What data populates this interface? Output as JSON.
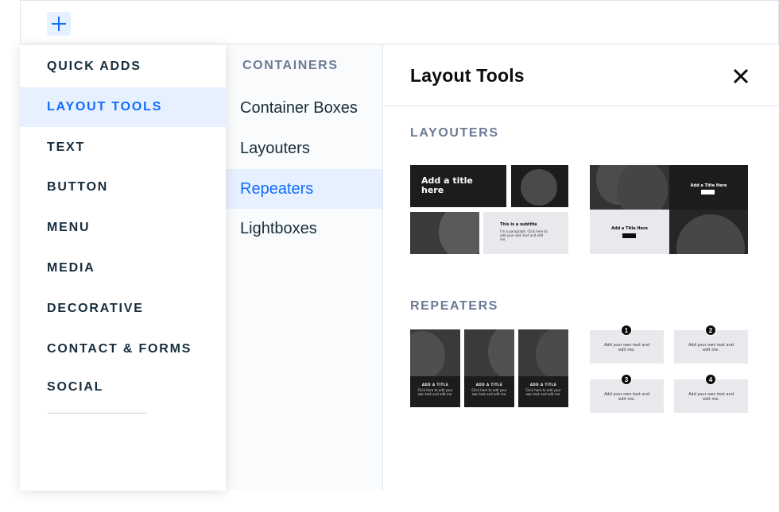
{
  "toolbar": {
    "add_icon": "plus-icon"
  },
  "categories": [
    {
      "label": "QUICK ADDS",
      "active": false
    },
    {
      "label": "LAYOUT TOOLS",
      "active": true
    },
    {
      "label": "TEXT",
      "active": false
    },
    {
      "label": "BUTTON",
      "active": false
    },
    {
      "label": "MENU",
      "active": false
    },
    {
      "label": "MEDIA",
      "active": false
    },
    {
      "label": "DECORATIVE",
      "active": false
    },
    {
      "label": "CONTACT & FORMS",
      "active": false
    },
    {
      "label": "SOCIAL",
      "active": false
    }
  ],
  "subcategories": {
    "heading": "CONTAINERS",
    "items": [
      {
        "label": "Container Boxes",
        "active": false
      },
      {
        "label": "Layouters",
        "active": false
      },
      {
        "label": "Repeaters",
        "active": true
      },
      {
        "label": "Lightboxes",
        "active": false
      }
    ]
  },
  "panel": {
    "title": "Layout Tools",
    "close_icon": "close-icon",
    "layouters": {
      "title": "LAYOUTERS",
      "thumb1": {
        "title": "Add a title here",
        "subtitle": "This is a subtitle",
        "paragraph": "I'm a paragraph. Click here to add your own text and edit me."
      },
      "thumb2": {
        "title_top": "Add a Title Here",
        "title_bottom": "Add a Title Here"
      }
    },
    "repeaters": {
      "title": "REPEATERS",
      "thumb1": {
        "item_title": "ADD A TITLE",
        "item_text": "Click here to add your own text and edit me."
      },
      "thumb2": {
        "items": [
          {
            "number": "1",
            "text": "Add your own text and edit me."
          },
          {
            "number": "2",
            "text": "Add your own text and edit me."
          },
          {
            "number": "3",
            "text": "Add your own text and edit me."
          },
          {
            "number": "4",
            "text": "Add your own text and edit me."
          }
        ]
      }
    }
  },
  "colors": {
    "accent": "#116dff",
    "active_bg": "#e7f0ff",
    "heading_gray": "#6b7a96",
    "text_dark": "#162d3d"
  }
}
